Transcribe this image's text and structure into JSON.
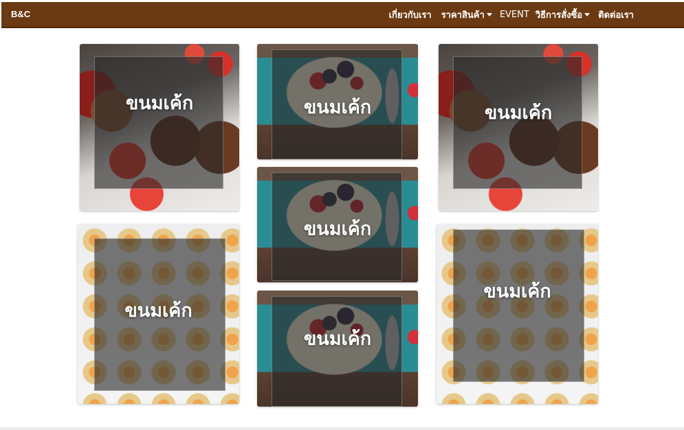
{
  "navbar": {
    "brand": "B&C",
    "items": [
      {
        "label": "เกี่ยวกับเรา",
        "dropdown": false,
        "bold": true
      },
      {
        "label": "ราคาสินค้า",
        "dropdown": true,
        "bold": true
      },
      {
        "label": "EVENT",
        "dropdown": false,
        "bold": false
      },
      {
        "label": "วิธีการสั่งซื้อ",
        "dropdown": true,
        "bold": true
      },
      {
        "label": "ติดต่อเรา",
        "dropdown": false,
        "bold": true
      }
    ],
    "colors": {
      "background": "#6b3a12",
      "text": "#ffffff"
    }
  },
  "cards": [
    {
      "label": "ขนมเค้ก",
      "photo": "chocolate-cake-strawberries"
    },
    {
      "label": "ขนมเค้ก",
      "photo": "yogurt-parfait-berries"
    },
    {
      "label": "ขนมเค้ก",
      "photo": "chocolate-cake-strawberries"
    },
    {
      "label": "ขนมเค้ก",
      "photo": "yogurt-parfait-berries"
    },
    {
      "label": "ขนมเค้ก",
      "photo": "fruit-tartlets-grid"
    },
    {
      "label": "ขนมเค้ก",
      "photo": "yogurt-parfait-berries"
    },
    {
      "label": "ขนมเค้ก",
      "photo": "fruit-tartlets-grid"
    }
  ]
}
